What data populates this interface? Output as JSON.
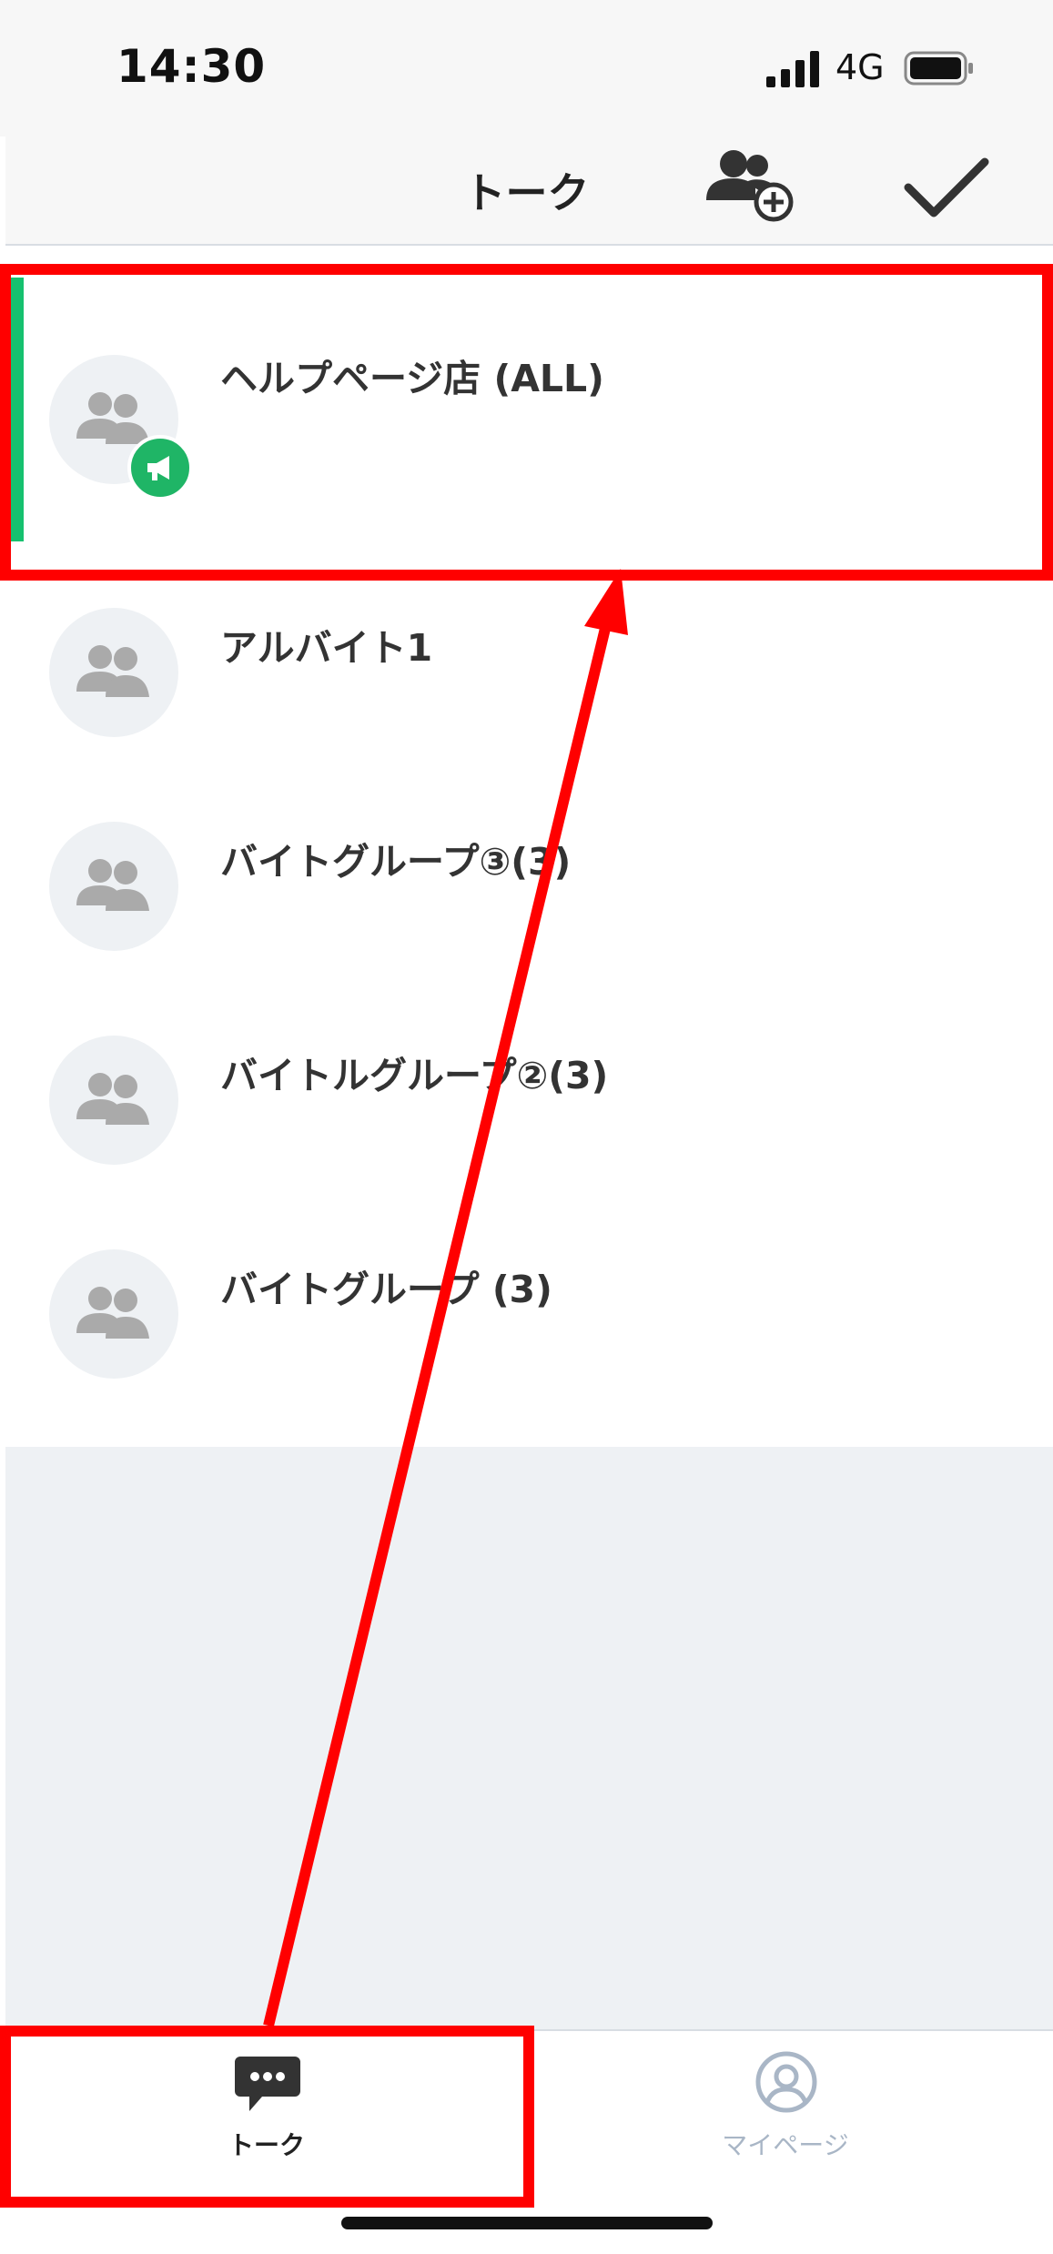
{
  "status_bar": {
    "time": "14:30",
    "network": "4G"
  },
  "header": {
    "title": "トーク"
  },
  "icons": {
    "add_group": "person-group-plus-icon",
    "confirm": "checkmark-icon",
    "avatar": "group-icon",
    "announcement": "megaphone-icon",
    "talk_tab": "chat-bubble-icon",
    "mypage_tab": "user-circle-icon"
  },
  "chats": [
    {
      "name": "ヘルプページ店 (ALL)",
      "announcement": true,
      "selected": true
    },
    {
      "name": "アルバイト1"
    },
    {
      "name": "バイトグループ③(3)"
    },
    {
      "name": "バイトルグループ②(3)"
    },
    {
      "name": "バイトグループ (3)"
    }
  ],
  "tabs": [
    {
      "label": "トーク",
      "active": true
    },
    {
      "label": "マイページ",
      "active": false
    }
  ],
  "colors": {
    "accent_green": "#16c16f",
    "badge_green": "#1fb566",
    "highlight_red": "#ff0000",
    "background_gray": "#eef1f4"
  }
}
